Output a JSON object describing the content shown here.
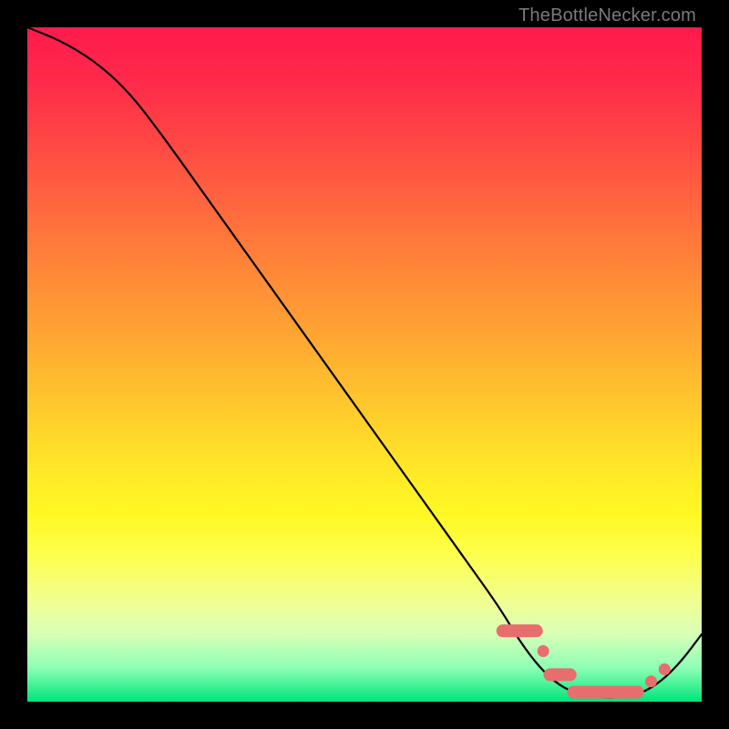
{
  "watermark": "TheBottleNecker.com",
  "chart_data": {
    "type": "line",
    "title": "",
    "xlabel": "",
    "ylabel": "",
    "xlim": [
      0,
      100
    ],
    "ylim": [
      0,
      100
    ],
    "series": [
      {
        "name": "curve",
        "x": [
          0,
          5,
          10,
          15,
          20,
          25,
          30,
          35,
          40,
          45,
          50,
          55,
          60,
          65,
          70,
          73,
          76,
          79,
          82,
          85,
          88,
          91,
          94,
          97,
          100
        ],
        "y": [
          100,
          98,
          95,
          90.5,
          84,
          77,
          70,
          63,
          56,
          49,
          42,
          35,
          28,
          21,
          14,
          9,
          5,
          2.3,
          1.0,
          0.6,
          0.6,
          1.2,
          3.0,
          6.0,
          10
        ]
      }
    ],
    "markers": [
      {
        "type": "pill",
        "x0": 70.5,
        "x1": 75.5,
        "y": 10.5
      },
      {
        "type": "dot",
        "x": 76.5,
        "y": 7.5
      },
      {
        "type": "pill",
        "x0": 77.5,
        "x1": 80.5,
        "y": 4.0
      },
      {
        "type": "pill",
        "x0": 81.0,
        "x1": 90.5,
        "y": 1.4
      },
      {
        "type": "dot",
        "x": 92.5,
        "y": 3.0
      },
      {
        "type": "dot",
        "x": 94.5,
        "y": 4.8
      }
    ]
  }
}
